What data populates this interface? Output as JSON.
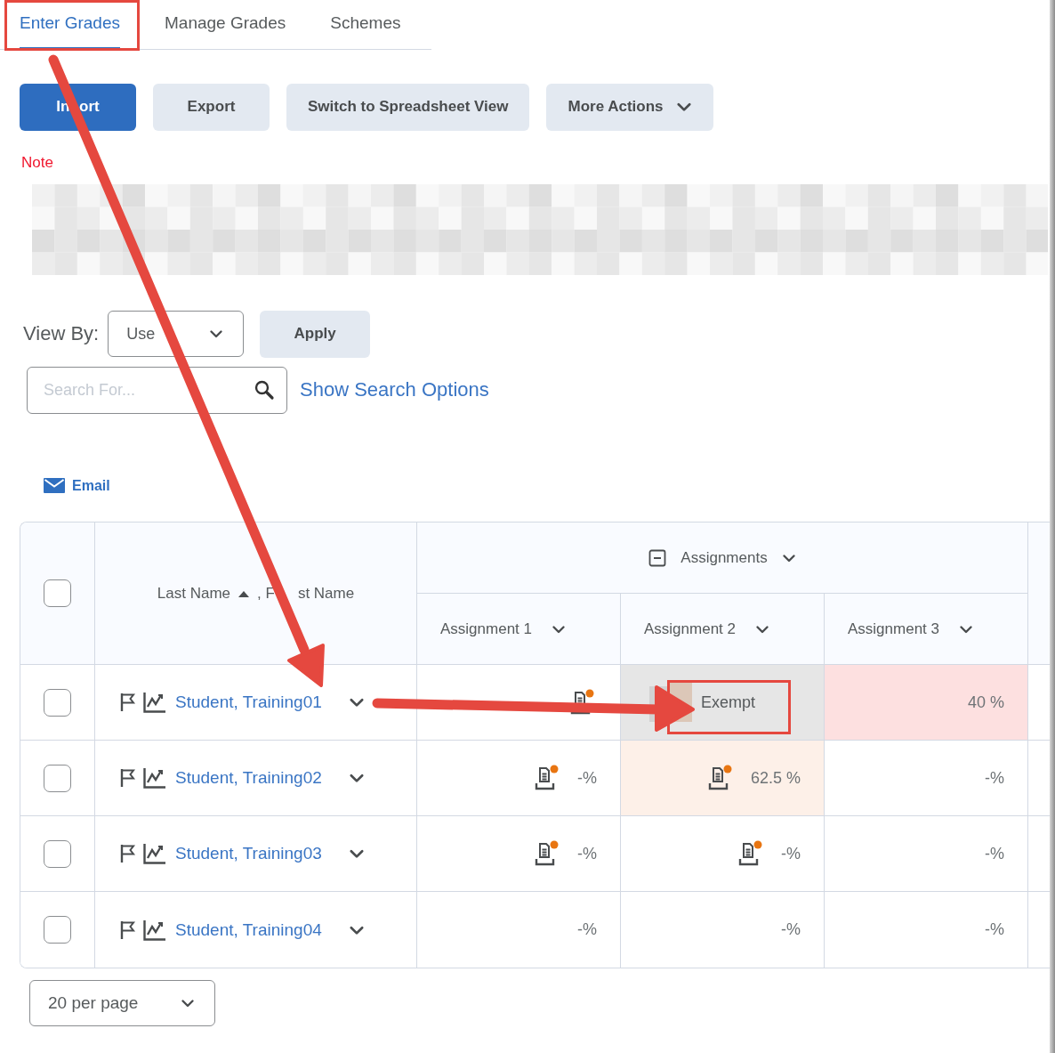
{
  "tabs": [
    {
      "label": "Enter Grades",
      "selected": true
    },
    {
      "label": "Manage Grades",
      "selected": false
    },
    {
      "label": "Schemes",
      "selected": false
    }
  ],
  "toolbar": {
    "buttons": [
      {
        "label": "In ort",
        "kind": "primary"
      },
      {
        "label": "Export",
        "kind": "secondary"
      },
      {
        "label": "Switch to Spreadsheet View",
        "kind": "secondary"
      },
      {
        "label": "More Actions",
        "kind": "menu"
      }
    ]
  },
  "note": {
    "label": "Note"
  },
  "view_by": {
    "label": "View By:",
    "value": "Use",
    "apply": "Apply"
  },
  "search": {
    "placeholder": "Search For...",
    "options_link": "Show Search Options"
  },
  "email_link": "Email",
  "table": {
    "group": "Assignments",
    "select_all": {
      "checked": false
    },
    "name_header": {
      "last": "Last Name",
      "first": [
        ", F",
        "st Name"
      ]
    },
    "columns": [
      "Assignment 1",
      "Assignment 2",
      "Assignment 3"
    ],
    "rows": [
      {
        "name": "Student, Training01",
        "checked": false,
        "cells": [
          {
            "kind": "grade",
            "submission": true,
            "color": "#ffffff"
          },
          {
            "kind": "exempt",
            "value": "Exempt",
            "submission": false,
            "color": "#e6e6e6"
          },
          {
            "kind": "grade",
            "value": "40 %",
            "submission": false,
            "color": "#fde0e0"
          }
        ]
      },
      {
        "name": "Student, Training02",
        "checked": false,
        "cells": [
          {
            "kind": "grade",
            "value": "-%",
            "submission": true,
            "color": "#ffffff"
          },
          {
            "kind": "grade",
            "value": "62.5 %",
            "submission": true,
            "color": "#fdf0e8"
          },
          {
            "kind": "grade",
            "value": "-%",
            "submission": false,
            "color": "#ffffff"
          }
        ]
      },
      {
        "name": "Student, Training03",
        "checked": false,
        "cells": [
          {
            "kind": "grade",
            "value": "-%",
            "submission": true,
            "color": "#ffffff"
          },
          {
            "kind": "grade",
            "value": "-%",
            "submission": true,
            "color": "#ffffff"
          },
          {
            "kind": "grade",
            "value": "-%",
            "submission": false,
            "color": "#ffffff"
          }
        ]
      },
      {
        "name": "Student, Training04",
        "checked": false,
        "cells": [
          {
            "kind": "grade",
            "value": "-%",
            "submission": false,
            "color": "#ffffff"
          },
          {
            "kind": "grade",
            "value": "-%",
            "submission": false,
            "color": "#ffffff"
          },
          {
            "kind": "grade",
            "value": "-%",
            "submission": false,
            "color": "#ffffff"
          }
        ]
      }
    ]
  },
  "pagination": {
    "value": "20 per page"
  }
}
